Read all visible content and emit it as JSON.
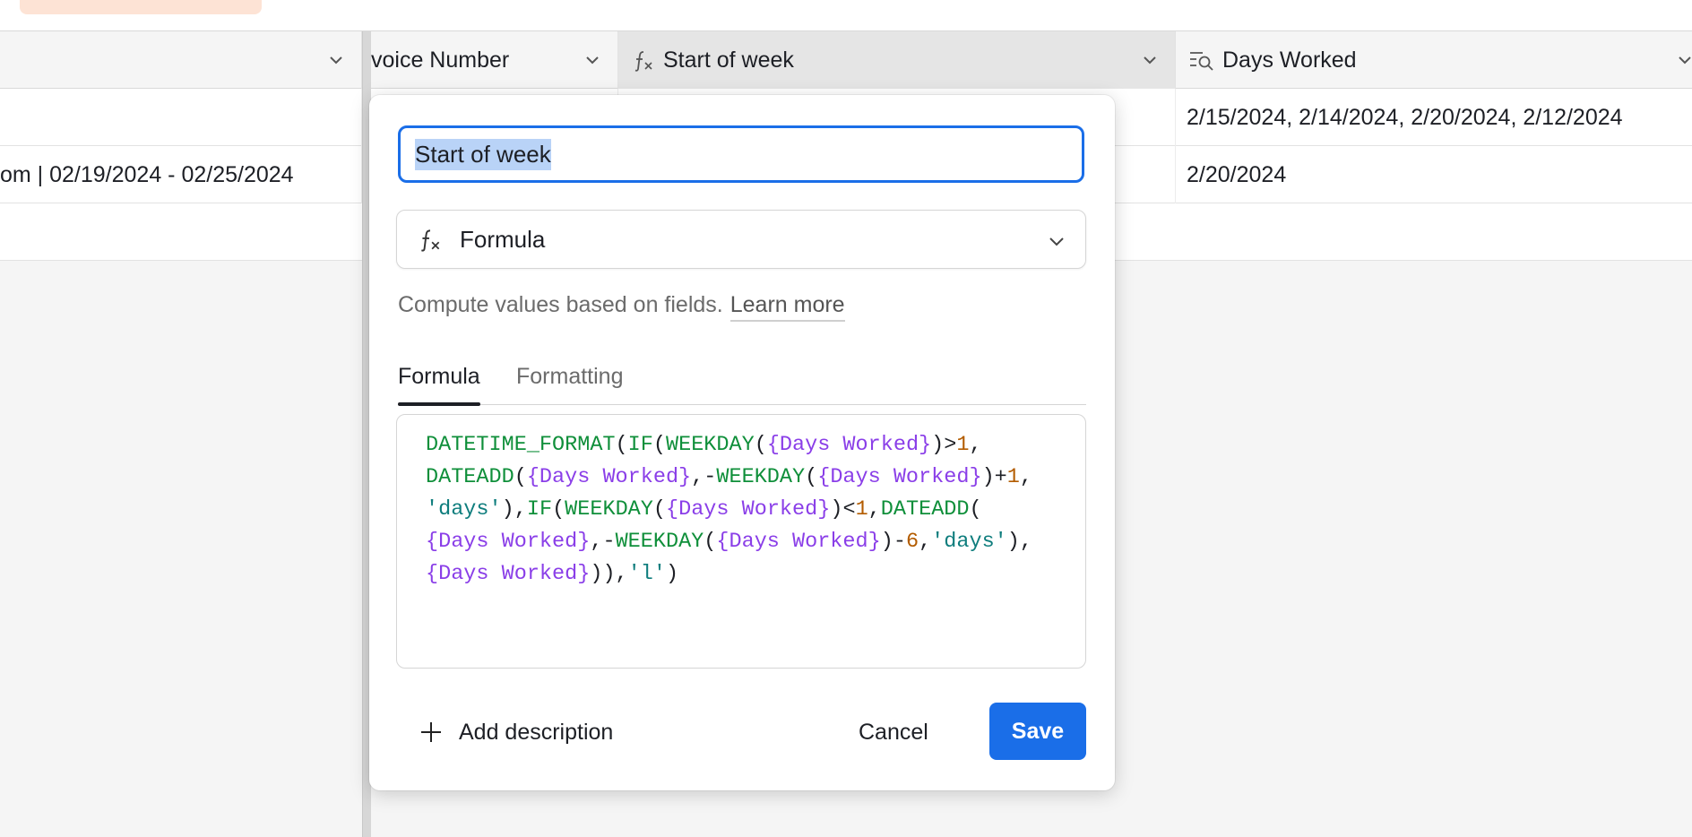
{
  "toolbar": {
    "items": [
      "",
      ""
    ]
  },
  "grid": {
    "columns": [
      {
        "label": ""
      },
      {
        "label": "voice Number"
      },
      {
        "label": "Start of week"
      },
      {
        "label": "Days Worked"
      }
    ],
    "rows": [
      {
        "cells": [
          "",
          "",
          "",
          "2/15/2024, 2/14/2024, 2/20/2024, 2/12/2024"
        ]
      },
      {
        "cells": [
          "om | 02/19/2024 - 02/25/2024",
          "",
          "",
          "2/20/2024"
        ]
      }
    ]
  },
  "popover": {
    "field_name": "Start of week",
    "field_type": "Formula",
    "helper_text": "Compute values based on fields.",
    "learn_more": "Learn more",
    "tabs": [
      {
        "label": "Formula",
        "active": true
      },
      {
        "label": "Formatting",
        "active": false
      }
    ],
    "formula": {
      "t1": "DATETIME_FORMAT",
      "t2": "(",
      "t3": "IF",
      "t4": "(",
      "t5": "WEEKDAY",
      "t6": "(",
      "t7": "{Days Worked}",
      "t8": ")>",
      "t9": "1",
      "t10": ",",
      "t11": "DATEADD",
      "t12": "(",
      "t13": "{Days Worked}",
      "t14": ",-",
      "t15": "WEEKDAY",
      "t16": "(",
      "t17": "{Days Worked}",
      "t18": ")+",
      "t19": "1",
      "t20": ",",
      "t21": "'days'",
      "t22": "),",
      "t23": "IF",
      "t24": "(",
      "t25": "WEEKDAY",
      "t26": "(",
      "t27": "{Days Worked}",
      "t28": ")<",
      "t29": "1",
      "t30": ",",
      "t31": "DATEADD",
      "t32": "(",
      "t33": "{Days Worked}",
      "t34": ",-",
      "t35": "WEEKDAY",
      "t36": "(",
      "t37": "{Days Worked}",
      "t38": ")-",
      "t39": "6",
      "t40": ",",
      "t41": "'days'",
      "t42": "),",
      "t43": "{Days Worked}",
      "t44": ")),",
      "t45": "'l'",
      "t46": ")"
    },
    "add_description": "Add description",
    "cancel": "Cancel",
    "save": "Save"
  },
  "colors": {
    "accent": "#1a6ee8",
    "function": "#0f8f3a",
    "field": "#8a3ee8",
    "number": "#b35c00",
    "string": "#0e7d7d"
  },
  "icons": {
    "formula": "fx-icon",
    "lookup": "lookup-icon",
    "chevron": "chevron-down-icon",
    "add": "plus-icon"
  }
}
